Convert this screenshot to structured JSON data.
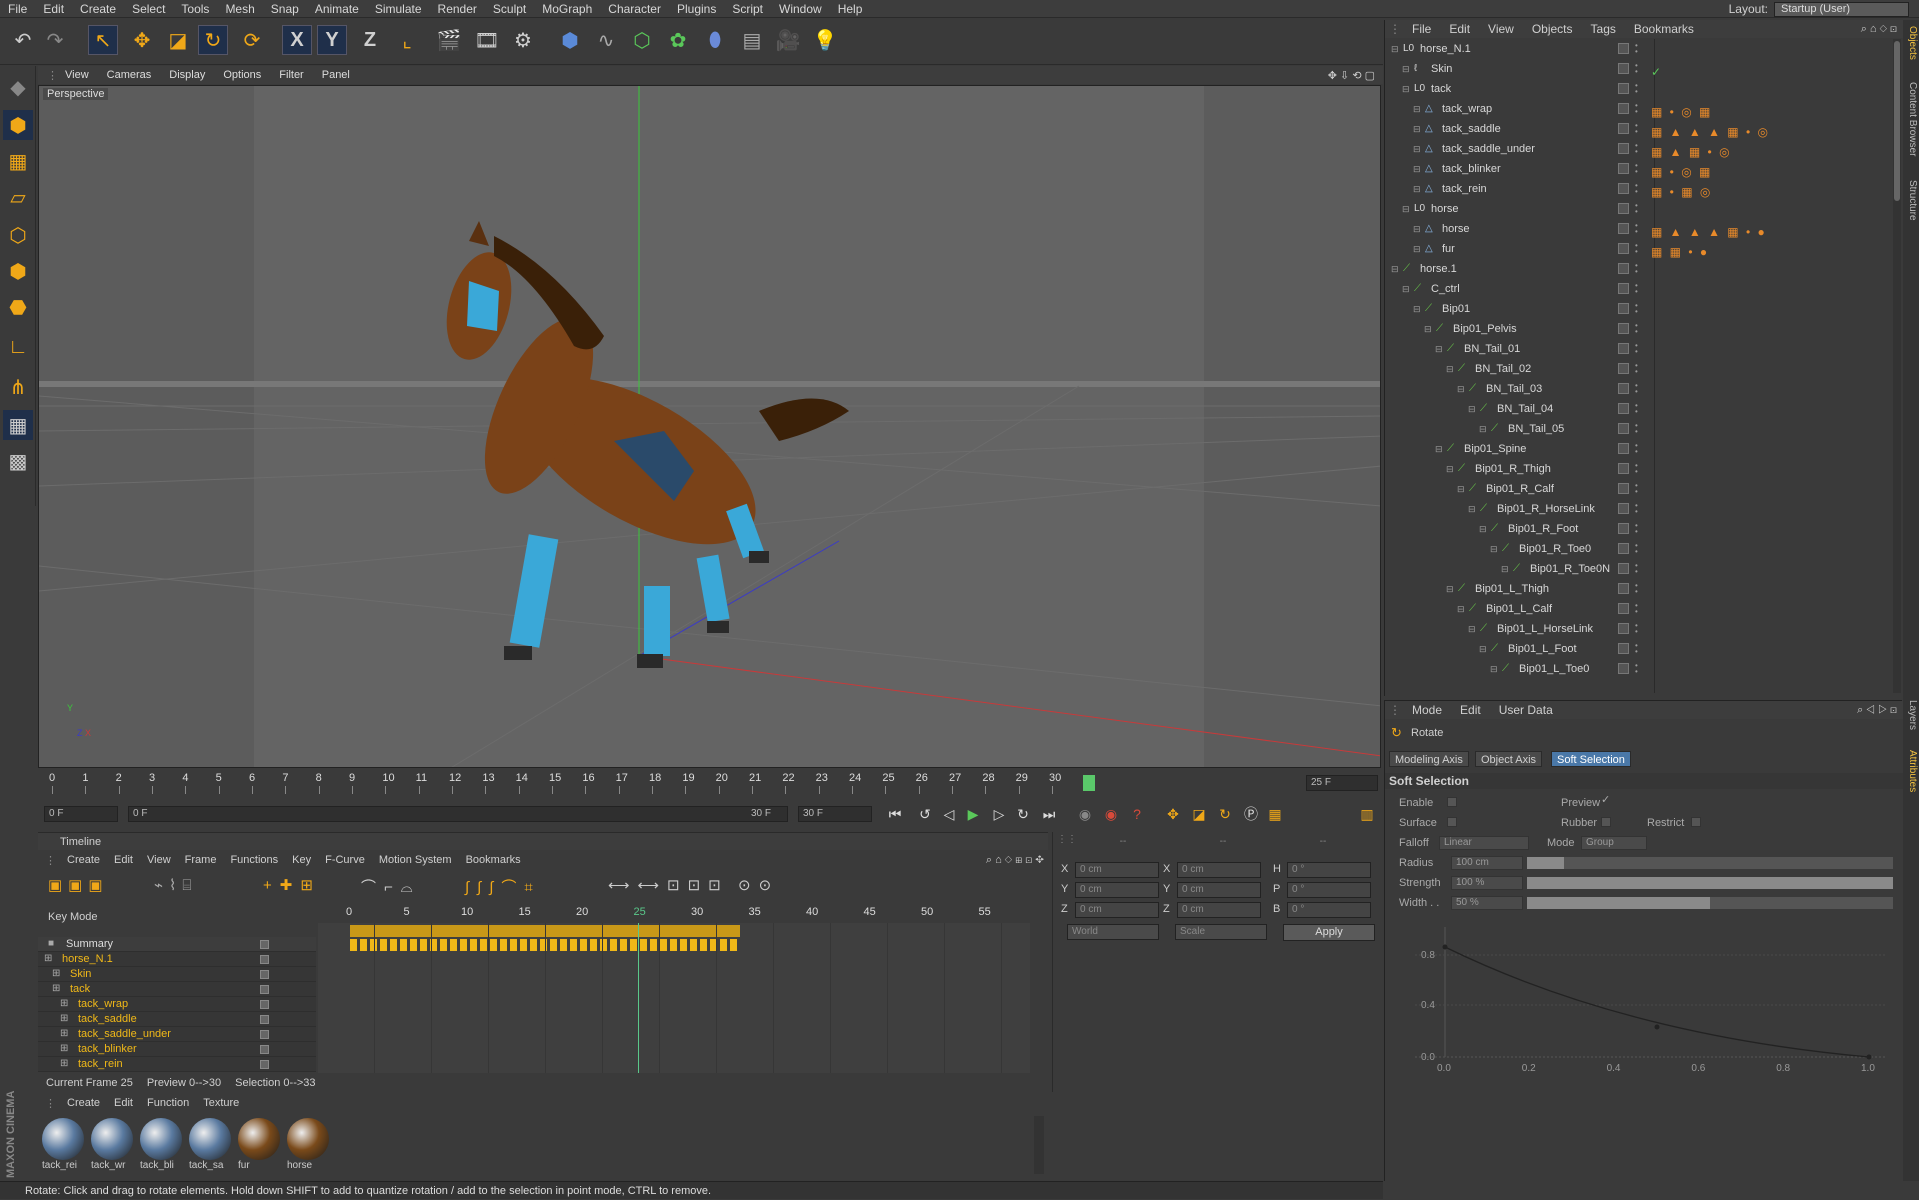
{
  "menubar": {
    "items": [
      "File",
      "Edit",
      "Create",
      "Select",
      "Tools",
      "Mesh",
      "Snap",
      "Animate",
      "Simulate",
      "Render",
      "Sculpt",
      "MoGraph",
      "Character",
      "Plugins",
      "Script",
      "Window",
      "Help"
    ],
    "layout_label": "Layout:",
    "layout_value": "Startup (User)"
  },
  "toolbar": {
    "axis_x": "X",
    "axis_y": "Y",
    "axis_z": "Z"
  },
  "viewport": {
    "menu": [
      "View",
      "Cameras",
      "Display",
      "Options",
      "Filter",
      "Panel"
    ],
    "camera_label": "Perspective",
    "axis_y": "Y",
    "axis_x": "X",
    "axis_z": "Z"
  },
  "timeruler": {
    "ticks": [
      "0",
      "1",
      "2",
      "3",
      "4",
      "5",
      "6",
      "7",
      "8",
      "9",
      "10",
      "11",
      "12",
      "13",
      "14",
      "15",
      "16",
      "17",
      "18",
      "19",
      "20",
      "21",
      "22",
      "23",
      "24",
      "25",
      "26",
      "27",
      "28",
      "29",
      "30"
    ],
    "current_frame_box": "25 F"
  },
  "playbar": {
    "start_frame": "0 F",
    "range_start": "0 F",
    "range_end": "30 F",
    "end_frame": "30 F"
  },
  "timeline": {
    "title": "Timeline",
    "menu": [
      "Create",
      "Edit",
      "View",
      "Frame",
      "Functions",
      "Key",
      "F-Curve",
      "Motion System",
      "Bookmarks"
    ],
    "key_mode_label": "Key Mode",
    "ruler_ticks": [
      "0",
      "5",
      "10",
      "15",
      "20",
      "25",
      "30",
      "35",
      "40",
      "45",
      "50",
      "55"
    ],
    "current_tick": "25",
    "tracks": [
      {
        "name": "Summary"
      },
      {
        "name": "horse_N.1"
      },
      {
        "name": "Skin"
      },
      {
        "name": "tack"
      },
      {
        "name": "tack_wrap"
      },
      {
        "name": "tack_saddle"
      },
      {
        "name": "tack_saddle_under"
      },
      {
        "name": "tack_blinker"
      },
      {
        "name": "tack_rein"
      }
    ],
    "status": {
      "current_frame": "Current Frame  25",
      "preview": "Preview  0-->30",
      "selection": "Selection 0-->33"
    }
  },
  "coords": {
    "header": [
      "--",
      "--",
      "--"
    ],
    "rows": [
      {
        "a": "X",
        "av": "0 cm",
        "b": "X",
        "bv": "0 cm",
        "c": "H",
        "cv": "0 °"
      },
      {
        "a": "Y",
        "av": "0 cm",
        "b": "Y",
        "bv": "0 cm",
        "c": "P",
        "cv": "0 °"
      },
      {
        "a": "Z",
        "av": "0 cm",
        "b": "Z",
        "bv": "0 cm",
        "c": "B",
        "cv": "0 °"
      }
    ],
    "world": "World",
    "scale": "Scale",
    "apply": "Apply"
  },
  "materials": {
    "menu": [
      "Create",
      "Edit",
      "Function",
      "Texture"
    ],
    "items": [
      {
        "name": "tack_rei",
        "color": "#5a7aa0"
      },
      {
        "name": "tack_wr",
        "color": "#5a7aa0"
      },
      {
        "name": "tack_bli",
        "color": "#5a7aa0"
      },
      {
        "name": "tack_sa",
        "color": "#5a7aa0"
      },
      {
        "name": "fur",
        "color": "#7a4a1a"
      },
      {
        "name": "horse",
        "color": "#7a4a1a"
      }
    ]
  },
  "statusbar": "Rotate: Click and drag to rotate elements. Hold down SHIFT to add to quantize rotation / add to the selection in point mode, CTRL to remove.",
  "brand": "MAXON CINEMA 4D",
  "objects": {
    "menu": [
      "File",
      "Edit",
      "View",
      "Objects",
      "Tags",
      "Bookmarks"
    ],
    "rows": [
      {
        "name": "horse_N.1",
        "depth": 0,
        "icon": "null"
      },
      {
        "name": "Skin",
        "depth": 1,
        "icon": "skin",
        "tag": "✓"
      },
      {
        "name": "tack",
        "depth": 1,
        "icon": "null"
      },
      {
        "name": "tack_wrap",
        "depth": 2,
        "icon": "mesh",
        "tag": "▦ • ◎ ▦"
      },
      {
        "name": "tack_saddle",
        "depth": 2,
        "icon": "mesh",
        "tag": "▦ ▲ ▲ ▲ ▦ • ◎"
      },
      {
        "name": "tack_saddle_under",
        "depth": 2,
        "icon": "mesh",
        "tag": "▦ ▲ ▦ • ◎"
      },
      {
        "name": "tack_blinker",
        "depth": 2,
        "icon": "mesh",
        "tag": "▦ • ◎ ▦"
      },
      {
        "name": "tack_rein",
        "depth": 2,
        "icon": "mesh",
        "tag": "▦ • ▦ ◎"
      },
      {
        "name": "horse",
        "depth": 1,
        "icon": "null"
      },
      {
        "name": "horse",
        "depth": 2,
        "icon": "mesh",
        "tag": "▦ ▲ ▲ ▲ ▦ • ●"
      },
      {
        "name": "fur",
        "depth": 2,
        "icon": "mesh",
        "tag": "▦ ▦ • ●"
      },
      {
        "name": "horse.1",
        "depth": 0,
        "icon": "bone"
      },
      {
        "name": "C_ctrl",
        "depth": 1,
        "icon": "bone"
      },
      {
        "name": "Bip01",
        "depth": 2,
        "icon": "bone"
      },
      {
        "name": "Bip01_Pelvis",
        "depth": 3,
        "icon": "bone"
      },
      {
        "name": "BN_Tail_01",
        "depth": 4,
        "icon": "bone"
      },
      {
        "name": "BN_Tail_02",
        "depth": 5,
        "icon": "bone"
      },
      {
        "name": "BN_Tail_03",
        "depth": 6,
        "icon": "bone"
      },
      {
        "name": "BN_Tail_04",
        "depth": 7,
        "icon": "bone"
      },
      {
        "name": "BN_Tail_05",
        "depth": 8,
        "icon": "bone"
      },
      {
        "name": "Bip01_Spine",
        "depth": 4,
        "icon": "bone"
      },
      {
        "name": "Bip01_R_Thigh",
        "depth": 5,
        "icon": "bone"
      },
      {
        "name": "Bip01_R_Calf",
        "depth": 6,
        "icon": "bone"
      },
      {
        "name": "Bip01_R_HorseLink",
        "depth": 7,
        "icon": "bone"
      },
      {
        "name": "Bip01_R_Foot",
        "depth": 8,
        "icon": "bone"
      },
      {
        "name": "Bip01_R_Toe0",
        "depth": 9,
        "icon": "bone"
      },
      {
        "name": "Bip01_R_Toe0N",
        "depth": 10,
        "icon": "bone"
      },
      {
        "name": "Bip01_L_Thigh",
        "depth": 5,
        "icon": "bone"
      },
      {
        "name": "Bip01_L_Calf",
        "depth": 6,
        "icon": "bone"
      },
      {
        "name": "Bip01_L_HorseLink",
        "depth": 7,
        "icon": "bone"
      },
      {
        "name": "Bip01_L_Foot",
        "depth": 8,
        "icon": "bone"
      },
      {
        "name": "Bip01_L_Toe0",
        "depth": 9,
        "icon": "bone"
      }
    ]
  },
  "attributes": {
    "menu": [
      "Mode",
      "Edit",
      "User Data"
    ],
    "tool_name": "Rotate",
    "tabs": [
      "Modeling Axis",
      "Object Axis",
      "Soft Selection"
    ],
    "active_tab": "Soft Selection",
    "section": "Soft Selection",
    "enable": "Enable",
    "preview": "Preview",
    "surface": "Surface",
    "rubber": "Rubber",
    "restrict": "Restrict",
    "falloff": "Falloff",
    "falloff_value": "Linear",
    "mode": "Mode",
    "mode_value": "Group",
    "radius": "Radius",
    "radius_value": "100 cm",
    "radius_fraction": 0.1,
    "strength": "Strength",
    "strength_value": "100 %",
    "strength_fraction": 1.0,
    "width": "Width . .",
    "width_value": "50 %",
    "width_fraction": 0.5,
    "graph_x_ticks": [
      "0.0",
      "0.2",
      "0.4",
      "0.6",
      "0.8",
      "1.0"
    ],
    "graph_y_ticks": [
      "0.8",
      "0.4",
      "0.0"
    ]
  },
  "sidetabs": [
    "Objects",
    "Content Browser",
    "Structure",
    "Layers",
    "Attributes"
  ],
  "colors": {
    "accent": "#f0a818",
    "selected_tab": "#4a78a8",
    "bone": "#6aca4a"
  }
}
